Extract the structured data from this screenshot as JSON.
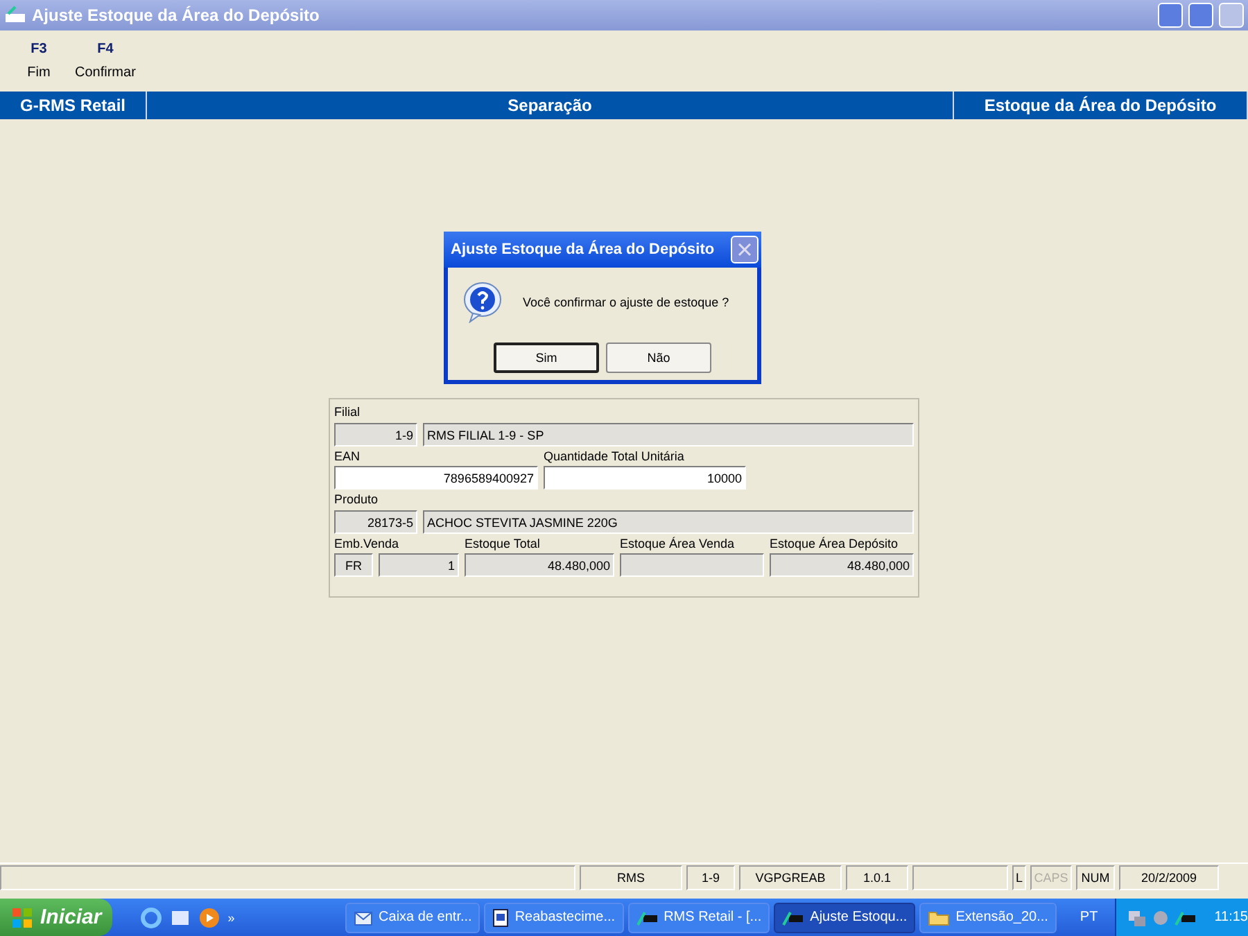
{
  "window": {
    "title": "Ajuste Estoque da Área do Depósito"
  },
  "toolbar": [
    {
      "key": "F3",
      "label": "Fim"
    },
    {
      "key": "F4",
      "label": "Confirmar"
    }
  ],
  "header": [
    "G-RMS Retail",
    "Separação",
    "Estoque da Área do Depósito"
  ],
  "dialog": {
    "title": "Ajuste Estoque da Área do Depósito",
    "message": "Você confirmar o ajuste de estoque ?",
    "buttons": [
      {
        "label": "Sim",
        "selected": true
      },
      {
        "label": "Não",
        "selected": false
      }
    ]
  },
  "form": {
    "filial_label": "Filial",
    "filial_code": "1-9",
    "filial_name": "RMS FILIAL 1-9 - SP",
    "ean_label": "EAN",
    "ean": "7896589400927",
    "qty_label": "Quantidade Total Unitária",
    "qty": "10000",
    "produto_label": "Produto",
    "produto_code": "28173-5",
    "produto_name": "ACHOC STEVITA JASMINE 220G",
    "emb_label": "Emb.Venda",
    "emb": "FR",
    "emb_qty": "1",
    "estoque_total_label": "Estoque Total",
    "estoque_total": "48.480,000",
    "area_venda_label": "Estoque Área Venda",
    "area_deposito_label": "Estoque Área Depósito",
    "area_deposito": "48.480,000"
  },
  "status_bar": [
    {
      "text": "RMS",
      "disabled": false
    },
    {
      "text": "1-9",
      "disabled": false
    },
    {
      "text": "VGPGREAB",
      "disabled": false
    },
    {
      "text": "1.0.1",
      "disabled": false
    },
    {
      "text": "L",
      "disabled": false
    },
    {
      "text": "CAPS",
      "disabled": true
    },
    {
      "text": "NUM",
      "disabled": false
    },
    {
      "text": "20/2/2009",
      "disabled": false
    }
  ],
  "taskbar": {
    "start": "Iniciar",
    "chevron": "»",
    "tasks": [
      {
        "label": "Caixa de entr...",
        "kind": "mail",
        "selected": false
      },
      {
        "label": "Reabastecime...",
        "kind": "doc",
        "selected": false
      },
      {
        "label": "RMS Retail - [...",
        "kind": "app",
        "selected": false
      },
      {
        "label": "Ajuste Estoqu...",
        "kind": "app",
        "selected": true
      },
      {
        "label": "Extensão_20...",
        "kind": "folder",
        "selected": false
      }
    ],
    "language": "PT",
    "clock": "11:15"
  }
}
